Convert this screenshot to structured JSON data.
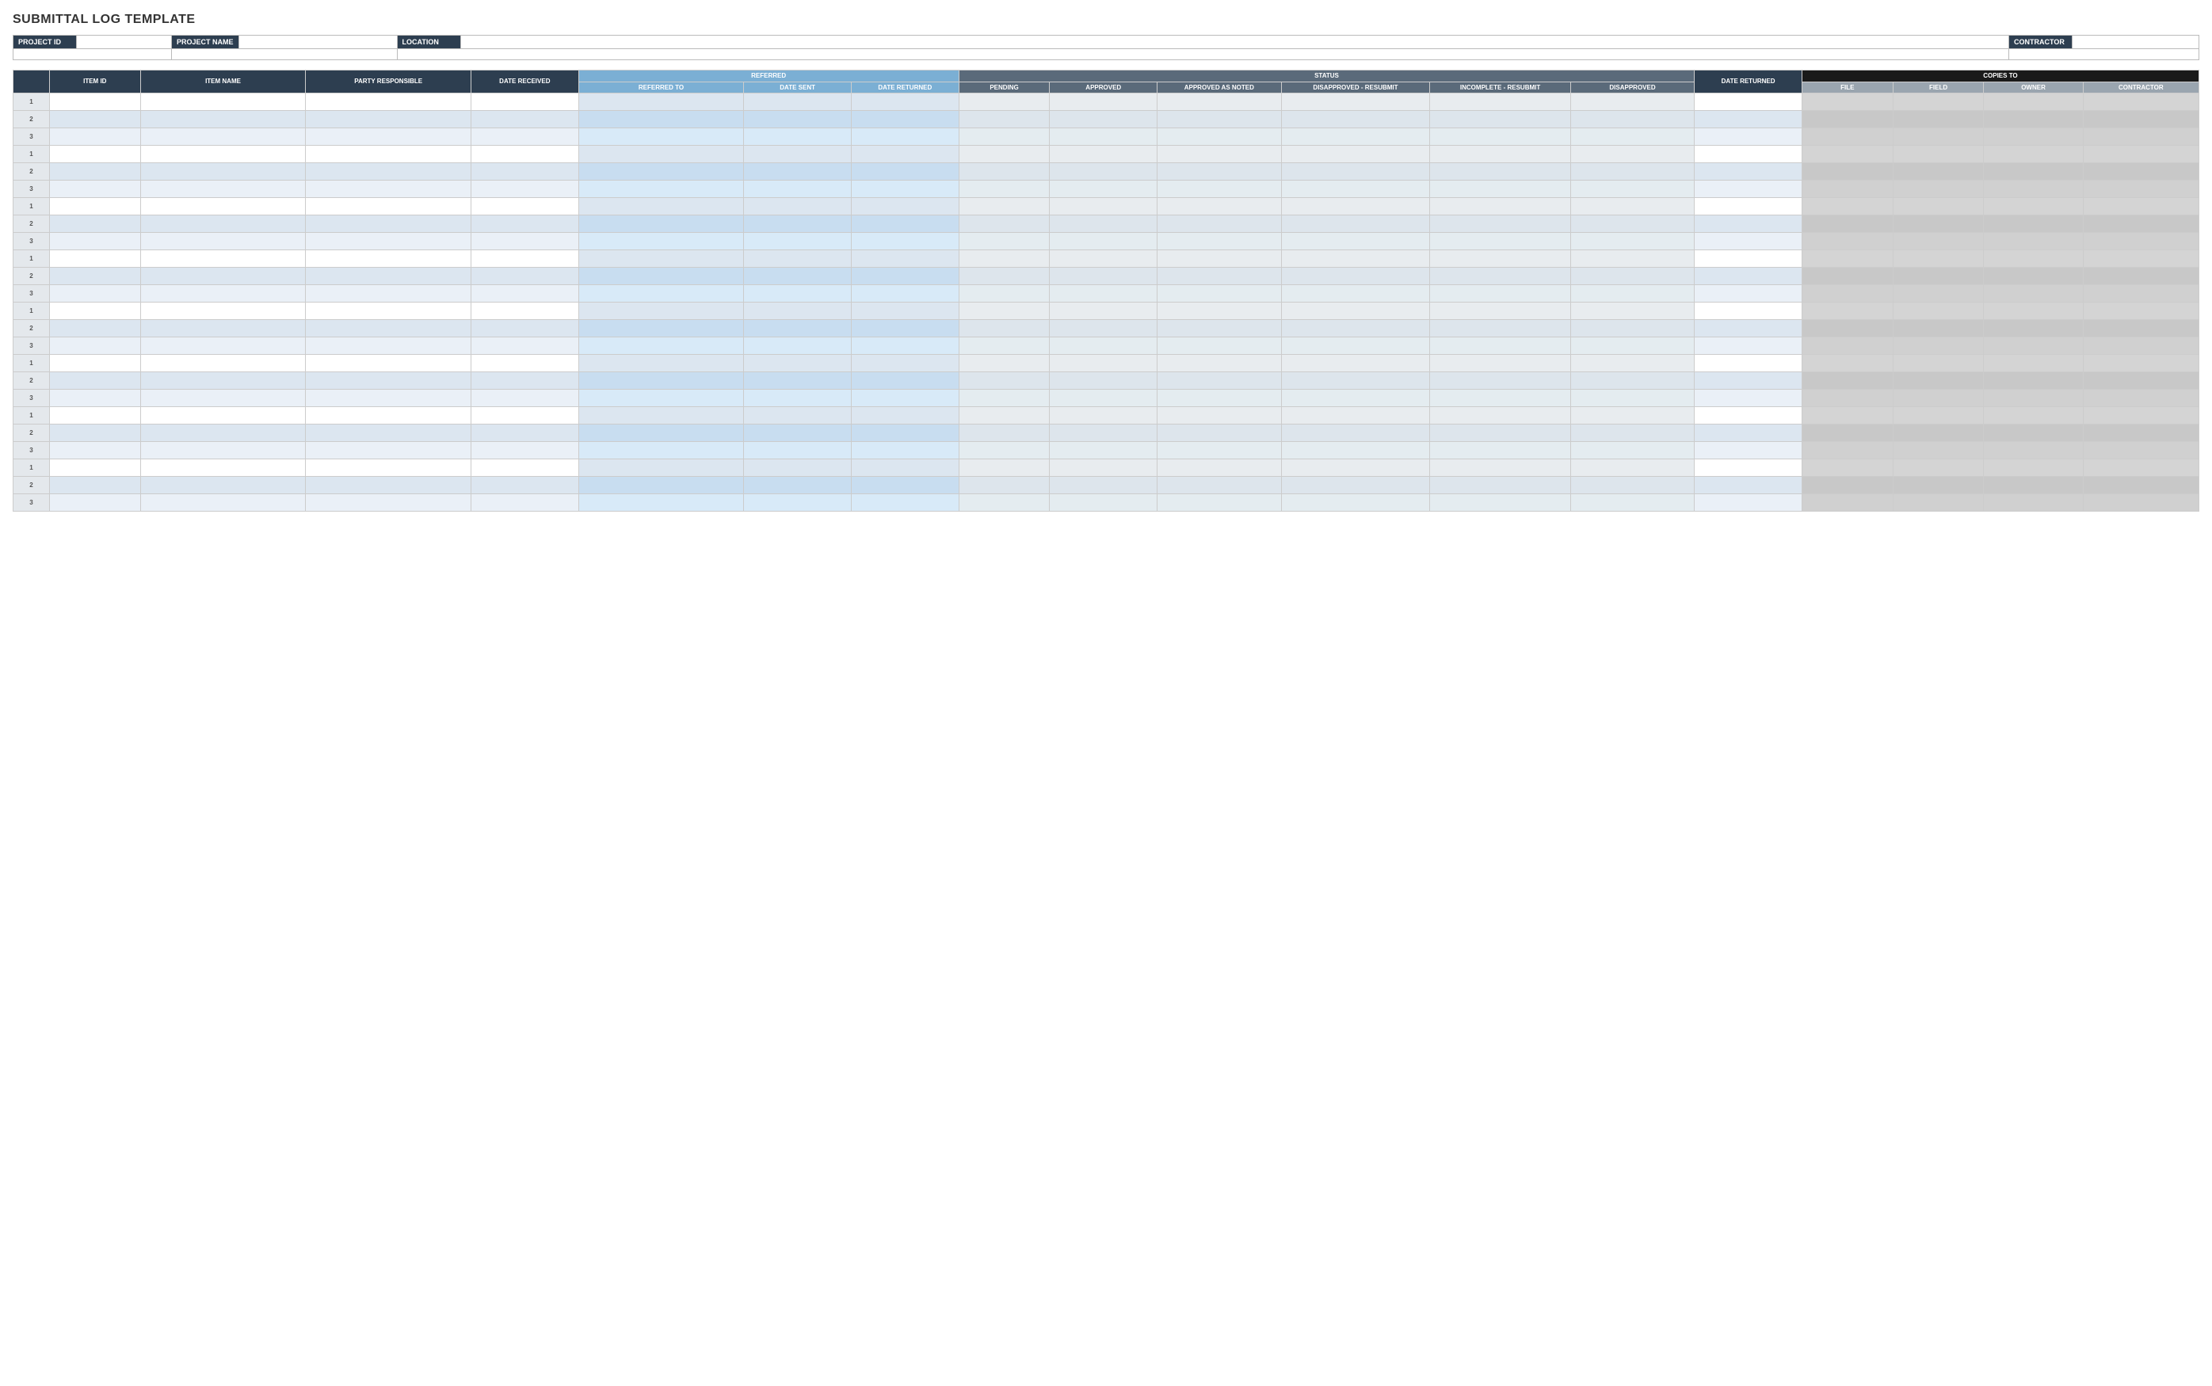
{
  "title": "SUBMITTAL LOG TEMPLATE",
  "info": {
    "project_id_label": "PROJECT ID",
    "project_name_label": "PROJECT NAME",
    "location_label": "LOCATION",
    "contractor_label": "CONTRACTOR",
    "project_id_value": "",
    "project_name_value": "",
    "location_value": "",
    "contractor_value": ""
  },
  "table": {
    "headers": {
      "referred_group": "REFERRED",
      "status_group": "STATUS",
      "copies_to_group": "COPIES TO",
      "item_id": "ITEM ID",
      "item_name": "ITEM NAME",
      "party_responsible": "PARTY RESPONSIBLE",
      "date_received": "DATE RECEIVED",
      "referred_to": "REFERRED TO",
      "date_sent": "DATE SENT",
      "date_returned": "DATE RETURNED",
      "pending": "PENDING",
      "approved": "APPROVED",
      "approved_as_noted": "APPROVED AS NOTED",
      "disapproved_resubmit": "DISAPPROVED - RESUBMIT",
      "incomplete_resubmit": "INCOMPLETE - RESUBMIT",
      "disapproved": "DISAPPROVED",
      "date_returned2": "DATE RETURNED",
      "file": "FILE",
      "field": "FIELD",
      "owner": "OWNER",
      "contractor": "CONTRACTOR"
    },
    "row_groups": [
      {
        "rows": [
          "1",
          "2",
          "3"
        ]
      },
      {
        "rows": [
          "1",
          "2",
          "3"
        ]
      },
      {
        "rows": [
          "1",
          "2",
          "3"
        ]
      },
      {
        "rows": [
          "1",
          "2",
          "3"
        ]
      },
      {
        "rows": [
          "1",
          "2",
          "3"
        ]
      },
      {
        "rows": [
          "1",
          "2",
          "3"
        ]
      },
      {
        "rows": [
          "1",
          "2",
          "3"
        ]
      },
      {
        "rows": [
          "1",
          "2",
          "3"
        ]
      }
    ]
  }
}
